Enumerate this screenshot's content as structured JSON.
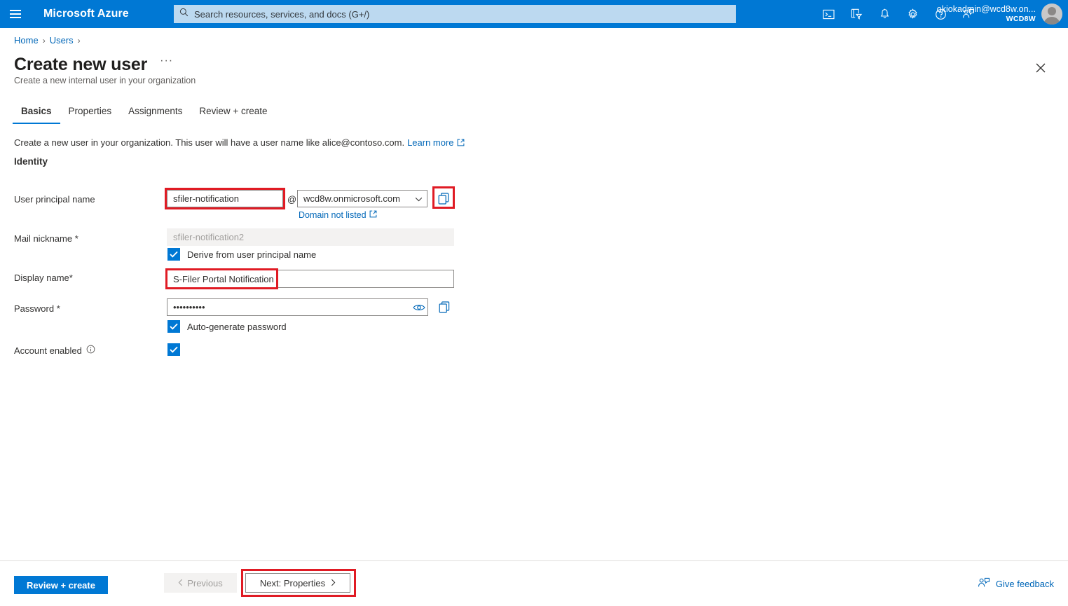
{
  "header": {
    "menu_icon": "hamburger-icon",
    "brand": "Microsoft Azure",
    "search": {
      "placeholder": "Search resources, services, and docs (G+/)",
      "value": "",
      "icon": "search-icon"
    },
    "icons": [
      {
        "name": "cloud-shell-icon",
        "title": "Cloud Shell"
      },
      {
        "name": "directory-filter-icon",
        "title": "Directories + subscriptions"
      },
      {
        "name": "notifications-bell-icon",
        "title": "Notifications"
      },
      {
        "name": "settings-gear-icon",
        "title": "Settings"
      },
      {
        "name": "help-question-icon",
        "title": "Help"
      },
      {
        "name": "feedback-icon",
        "title": "Feedback"
      }
    ],
    "account_name": "okiokadmin@wcd8w.on...",
    "account_org": "WCD8W",
    "avatar": "user-avatar"
  },
  "breadcrumb": {
    "items": [
      "Home",
      "Users"
    ],
    "separator": "›"
  },
  "page": {
    "title": "Create new user",
    "ellipsis": "···",
    "subtitle": "Create a new internal user in your organization",
    "close_label": "Close"
  },
  "tabs": [
    {
      "label": "Basics",
      "active": true
    },
    {
      "label": "Properties",
      "active": false
    },
    {
      "label": "Assignments",
      "active": false
    },
    {
      "label": "Review + create",
      "active": false
    }
  ],
  "intro": {
    "text": "Create a new user in your organization. This user will have a user name like alice@contoso.com.",
    "link": "Learn more"
  },
  "section": {
    "identity": "Identity"
  },
  "fields": {
    "upn": {
      "label": "User principal name",
      "value": "sfiler-notification",
      "at": "@",
      "domain_value": "wcd8w.onmicrosoft.com",
      "domain_link": "Domain not listed",
      "copy_icon": "copy-icon"
    },
    "mail_nickname": {
      "label": "Mail nickname *",
      "value": "sfiler-notification2",
      "derive_label": "Derive from user principal name",
      "derive_checked": true
    },
    "display_name": {
      "label": "Display name*",
      "value": "S-Filer Portal Notification"
    },
    "password": {
      "label": "Password *",
      "value": "••••••••••",
      "reveal_icon": "eye-icon",
      "copy_icon": "copy-icon",
      "autogen_label": "Auto-generate password",
      "autogen_checked": true
    },
    "account_enabled": {
      "label": "Account enabled",
      "info_icon": "info-icon",
      "checked": true
    }
  },
  "footer": {
    "review_create": "Review + create",
    "previous": "Previous",
    "next": "Next: Properties",
    "give_feedback": "Give feedback"
  },
  "colors": {
    "azure_blue": "#0078d4",
    "link_blue": "#0067b8",
    "highlight_red": "#e01b24",
    "disabled_grey": "#f3f2f1"
  }
}
